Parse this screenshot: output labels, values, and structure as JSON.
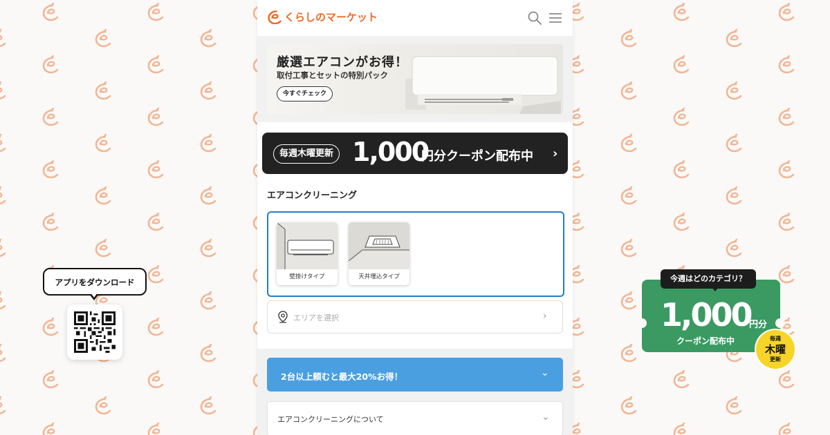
{
  "brand": {
    "name": "くらしのマーケット",
    "accent_color": "#ec6a26",
    "logo_icon": "kurashi-c-icon"
  },
  "header": {
    "search_icon": "search-icon",
    "menu_icon": "hamburger-menu-icon"
  },
  "hero": {
    "title": "厳選エアコンがお得！",
    "subtitle": "取付工事とセットの特別パック",
    "button_label": "今すぐチェック"
  },
  "coupon_bar": {
    "tag": "毎週木曜更新",
    "amount": "1,000",
    "text": "円分クーポン配布中",
    "arrow": "›"
  },
  "section": {
    "title": "エアコンクリーニング",
    "border_color": "#1f7ec8",
    "types": [
      {
        "label": "壁掛けタイプ",
        "icon": "wall-mounted-ac-icon"
      },
      {
        "label": "天井埋込タイプ",
        "icon": "ceiling-cassette-ac-icon"
      }
    ]
  },
  "area_select": {
    "placeholder": "エリアを選択",
    "icon": "location-pin-icon",
    "chevron": "›"
  },
  "promo": {
    "text": "2台以上頼むと最大20%お得！",
    "color": "#4a9fe0",
    "chevron": "⌄"
  },
  "about": {
    "text": "エアコンクリーニングについて",
    "chevron": "⌄"
  },
  "app_download": {
    "bubble_text": "アプリをダウンロード",
    "qr_icon": "qr-code-icon"
  },
  "side_coupon": {
    "label": "今週はどのカテゴリ？",
    "amount": "1,000",
    "yen": "円分",
    "text": "クーポン配布中",
    "color": "#3a9a62",
    "badge": {
      "line1": "毎週",
      "line2": "木曜",
      "line3": "更新",
      "color": "#f7d428"
    }
  }
}
